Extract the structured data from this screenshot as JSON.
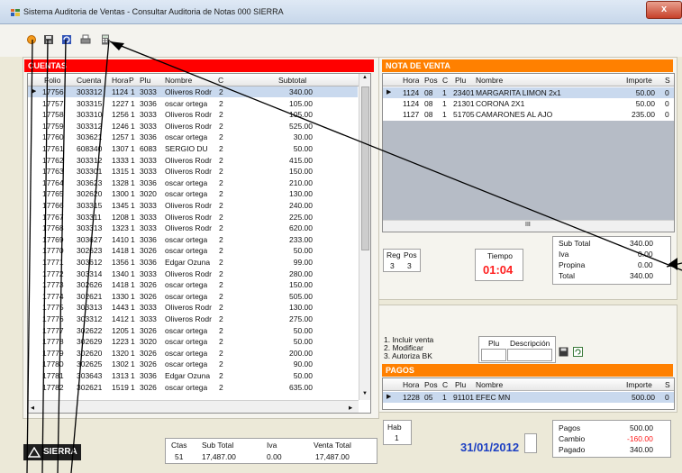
{
  "window": {
    "title": "Sistema Auditoria de Ventas - Consultar Auditoria de Notas   000 SIERRA",
    "close_label": "x"
  },
  "toolbar": {
    "icons": [
      "circle-icon",
      "save-icon",
      "refresh-icon",
      "print-icon",
      "calculator-icon"
    ]
  },
  "cuentas": {
    "header": "CUENTAS",
    "columns": [
      "Folio",
      "Cuenta",
      "Hora",
      "P",
      "Plu",
      "Nombre",
      "C",
      "Subtotal"
    ],
    "rows": [
      [
        "17756",
        "303312",
        "1124",
        "1",
        "3033",
        "Oliveros Rodr",
        "2",
        "340.00"
      ],
      [
        "17757",
        "303315",
        "1227",
        "1",
        "3036",
        "oscar ortega",
        "2",
        "105.00"
      ],
      [
        "17758",
        "303310",
        "1256",
        "1",
        "3033",
        "Oliveros Rodr",
        "2",
        "105.00"
      ],
      [
        "17759",
        "303312",
        "1246",
        "1",
        "3033",
        "Oliveros Rodr",
        "2",
        "525.00"
      ],
      [
        "17760",
        "303621",
        "1257",
        "1",
        "3036",
        "oscar ortega",
        "2",
        "30.00"
      ],
      [
        "17761",
        "608340",
        "1307",
        "1",
        "6083",
        "SERGIO DU",
        "2",
        "50.00"
      ],
      [
        "17762",
        "303312",
        "1333",
        "1",
        "3033",
        "Oliveros Rodr",
        "2",
        "415.00"
      ],
      [
        "17763",
        "303301",
        "1315",
        "1",
        "3033",
        "Oliveros Rodr",
        "2",
        "150.00"
      ],
      [
        "17764",
        "303623",
        "1328",
        "1",
        "3036",
        "oscar ortega",
        "2",
        "210.00"
      ],
      [
        "17765",
        "302620",
        "1300",
        "1",
        "3020",
        "oscar ortega",
        "2",
        "130.00"
      ],
      [
        "17766",
        "303315",
        "1345",
        "1",
        "3033",
        "Oliveros Rodr",
        "2",
        "240.00"
      ],
      [
        "17767",
        "303311",
        "1208",
        "1",
        "3033",
        "Oliveros Rodr",
        "2",
        "225.00"
      ],
      [
        "17768",
        "303313",
        "1323",
        "1",
        "3033",
        "Oliveros Rodr",
        "2",
        "620.00"
      ],
      [
        "17769",
        "303627",
        "1410",
        "1",
        "3036",
        "oscar ortega",
        "2",
        "233.00"
      ],
      [
        "17770",
        "302623",
        "1418",
        "1",
        "3026",
        "oscar ortega",
        "2",
        "50.00"
      ],
      [
        "17771",
        "303612",
        "1356",
        "1",
        "3036",
        "Edgar Ozuna",
        "2",
        "99.00"
      ],
      [
        "17772",
        "303314",
        "1340",
        "1",
        "3033",
        "Oliveros Rodr",
        "2",
        "280.00"
      ],
      [
        "17773",
        "302626",
        "1418",
        "1",
        "3026",
        "oscar ortega",
        "2",
        "150.00"
      ],
      [
        "17774",
        "302621",
        "1330",
        "1",
        "3026",
        "oscar ortega",
        "2",
        "505.00"
      ],
      [
        "17775",
        "303313",
        "1443",
        "1",
        "3033",
        "Oliveros Rodr",
        "2",
        "130.00"
      ],
      [
        "17776",
        "303312",
        "1412",
        "1",
        "3033",
        "Oliveros Rodr",
        "2",
        "275.00"
      ],
      [
        "17777",
        "302622",
        "1205",
        "1",
        "3026",
        "oscar ortega",
        "2",
        "50.00"
      ],
      [
        "17778",
        "302629",
        "1223",
        "1",
        "3020",
        "oscar ortega",
        "2",
        "50.00"
      ],
      [
        "17779",
        "302620",
        "1320",
        "1",
        "3026",
        "oscar ortega",
        "2",
        "200.00"
      ],
      [
        "17780",
        "302625",
        "1302",
        "1",
        "3026",
        "oscar ortega",
        "2",
        "90.00"
      ],
      [
        "17781",
        "303643",
        "1313",
        "1",
        "3036",
        "Edgar Ozuna",
        "2",
        "50.00"
      ],
      [
        "17782",
        "302621",
        "1519",
        "1",
        "3026",
        "oscar ortega",
        "2",
        "635.00"
      ]
    ],
    "scroll_up": "▲",
    "scroll_down": "▼",
    "scroll_left": "◂",
    "scroll_right": "▸"
  },
  "logo": {
    "text": "SIERRA"
  },
  "totals": {
    "headers": [
      "Ctas",
      "Sub Total",
      "Iva",
      "Venta Total"
    ],
    "values": [
      "51",
      "17,487.00",
      "0.00",
      "17,487.00"
    ]
  },
  "nota": {
    "header": "NOTA DE VENTA",
    "columns": [
      "Hora",
      "Pos",
      "C",
      "Plu",
      "Nombre",
      "Importe",
      "S"
    ],
    "rows": [
      [
        "1124",
        "08",
        "1",
        "23401",
        "MARGARITA LIMON 2x1",
        "50.00",
        "0"
      ],
      [
        "1124",
        "08",
        "1",
        "21301",
        "CORONA 2X1",
        "50.00",
        "0"
      ],
      [
        "1127",
        "08",
        "1",
        "51705",
        "CAMARONES AL AJO",
        "235.00",
        "0"
      ]
    ],
    "scroll_mid": "III"
  },
  "reg": {
    "labels": [
      "Reg",
      "Pos"
    ],
    "values": [
      "3",
      "3"
    ]
  },
  "tiempo": {
    "label": "Tiempo",
    "value": "01:04"
  },
  "summary": {
    "labels": [
      "Sub Total",
      "Iva",
      "Propina",
      "Total"
    ],
    "values": [
      "340.00",
      "0.00",
      "0.00",
      "340.00"
    ]
  },
  "instructions": [
    "1. Incluir venta",
    "2. Modificar",
    "3. Autoriza BK"
  ],
  "plu_search": {
    "columns": [
      "Plu",
      "Descripción"
    ]
  },
  "pagos": {
    "header": "PAGOS",
    "columns": [
      "Hora",
      "Pos",
      "C",
      "Plu",
      "Nombre",
      "Importe",
      "S"
    ],
    "rows": [
      [
        "1228",
        "05",
        "1",
        "91101",
        "EFEC MN",
        "500.00",
        "0"
      ]
    ],
    "scroll_mid": "III"
  },
  "hab": {
    "label": "Hab",
    "value": "1"
  },
  "date": "31/01/2012",
  "payment_summary": {
    "labels": [
      "Pagos",
      "Cambio",
      "Pagado"
    ],
    "values": [
      "500.00",
      "-160.00",
      "340.00"
    ]
  },
  "colors": {
    "red_header": "#ff0000",
    "orange_header": "#ff8000",
    "time_red": "#ff2020",
    "date_blue": "#1c3fc2",
    "selected_row": "#c9d9ee"
  }
}
